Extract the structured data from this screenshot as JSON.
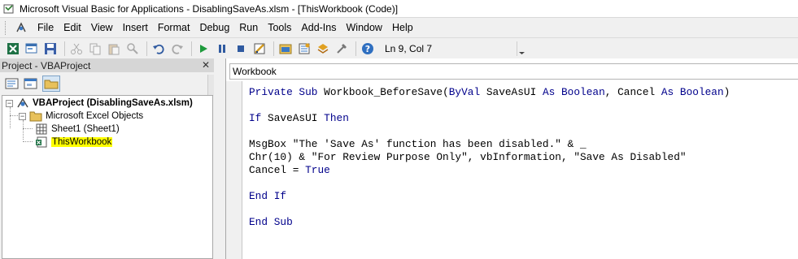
{
  "window": {
    "title": "Microsoft Visual Basic for Applications - DisablingSaveAs.xlsm - [ThisWorkbook (Code)]"
  },
  "menubar": {
    "items": [
      "File",
      "Edit",
      "View",
      "Insert",
      "Format",
      "Debug",
      "Run",
      "Tools",
      "Add-Ins",
      "Window",
      "Help"
    ]
  },
  "toolbar": {
    "buttons": [
      "view-excel",
      "insert-userform",
      "save",
      "cut",
      "copy",
      "paste",
      "find",
      "undo",
      "redo",
      "run",
      "break",
      "reset",
      "design-mode",
      "project-explorer",
      "properties-window",
      "object-browser",
      "toolbox",
      "help"
    ],
    "status": "Ln 9, Col 7"
  },
  "project_pane": {
    "title": "Project - VBAProject",
    "tree": {
      "root": "VBAProject (DisablingSaveAs.xlsm)",
      "folder": "Microsoft Excel Objects",
      "items": [
        "Sheet1 (Sheet1)",
        "ThisWorkbook"
      ]
    }
  },
  "code_pane": {
    "object_selector": "Workbook",
    "lines": [
      {
        "t": [
          {
            "k": true,
            "s": "Private Sub "
          },
          {
            "k": false,
            "s": "Workbook_BeforeSave("
          },
          {
            "k": true,
            "s": "ByVal"
          },
          {
            "k": false,
            "s": " SaveAsUI "
          },
          {
            "k": true,
            "s": "As Boolean"
          },
          {
            "k": false,
            "s": ", Cancel "
          },
          {
            "k": true,
            "s": "As Boolean"
          },
          {
            "k": false,
            "s": ")"
          }
        ]
      },
      {
        "t": []
      },
      {
        "t": [
          {
            "k": true,
            "s": "If"
          },
          {
            "k": false,
            "s": " SaveAsUI "
          },
          {
            "k": true,
            "s": "Then"
          }
        ]
      },
      {
        "t": []
      },
      {
        "t": [
          {
            "k": false,
            "s": "MsgBox \"The 'Save As' function has been disabled.\" & _"
          }
        ]
      },
      {
        "t": [
          {
            "k": false,
            "s": "Chr(10) & \"For Review Purpose Only\", vbInformation, \"Save As Disabled\""
          }
        ]
      },
      {
        "t": [
          {
            "k": false,
            "s": "Cancel = "
          },
          {
            "k": true,
            "s": "True"
          }
        ]
      },
      {
        "t": []
      },
      {
        "t": [
          {
            "k": true,
            "s": "End If"
          }
        ]
      },
      {
        "t": []
      },
      {
        "t": [
          {
            "k": true,
            "s": "End Sub"
          }
        ]
      }
    ]
  },
  "colors": {
    "keyword": "#00008b",
    "highlight": "#ffff00"
  }
}
